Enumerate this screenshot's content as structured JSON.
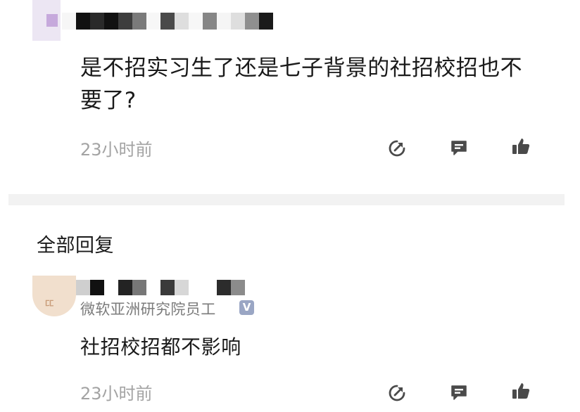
{
  "post": {
    "text": "是不招实习生了还是七子背景的社招校招也不要了?",
    "time": "23小时前",
    "author_pixels": [
      "#f6f6f6",
      "#111111",
      "#2a2a2a",
      "#111111",
      "#3d3d3d",
      "#7a7a7a",
      "#f7f7f7",
      "#4a4a4a",
      "#dedede",
      "#f7f7f7",
      "#868686",
      "#f5f5f5",
      "#dedede",
      "#8f8f8f",
      "#1a1a1a"
    ]
  },
  "section": {
    "title": "全部回复"
  },
  "reply": {
    "badge": "微软亚洲研究院员工",
    "verified_mark": "V",
    "text": "社招校招都不影响",
    "time": "23小时前",
    "author_pixels": [
      "#cfcfcf",
      "#111111",
      "#ffffff",
      "#232323",
      "#777777",
      "#ffffff",
      "#3a3a3a",
      "#d7d7d7",
      "#ffffff",
      "#ffffff",
      "#2c2c2c",
      "#8b8b8b"
    ]
  },
  "icons": {
    "share": "share-icon",
    "comment": "comment-icon",
    "like": "thumbs-up-icon"
  },
  "colors": {
    "text": "#1a1a1a",
    "muted": "#a3a3a3",
    "icon": "#4a4a4a",
    "verified": "#9aa6c4",
    "divider": "#f2f2f2"
  }
}
